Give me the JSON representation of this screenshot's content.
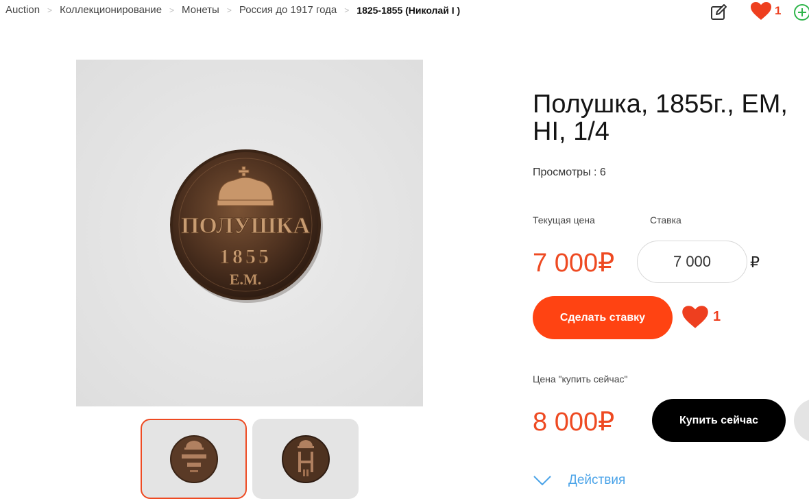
{
  "breadcrumb": {
    "items": [
      "Auction",
      "Коллекционирование",
      "Монеты",
      "Россия до 1917 года"
    ],
    "separator": ">",
    "current": "1825-1855 (Николай I )"
  },
  "header": {
    "favorites_count": "1",
    "icons": [
      "edit-icon",
      "heart-icon",
      "add-circle-icon"
    ]
  },
  "coin": {
    "obverse_legend": "ПОЛУШКА",
    "obverse_year": "1855",
    "obverse_mint": "Е.М."
  },
  "lot": {
    "title": "Полушка, 1855г., ЕМ, HI, 1/4",
    "views": "Просмотры : 6",
    "current_price_label": "Текущая цена",
    "bid_label": "Ставка",
    "current_price": "7 000₽",
    "bid_value": "7 000",
    "currency": "₽",
    "bid_button": "Сделать ставку",
    "likes": "1",
    "buy_now_label": "Цена \"купить сейчас\"",
    "buy_now_price": "8 000₽",
    "buy_now_button": "Купить сейчас",
    "actions_label": "Действия"
  },
  "colors": {
    "accent": "#ff4312",
    "price": "#ee4a22",
    "link": "#4aa3e8",
    "dark": "#000000"
  }
}
